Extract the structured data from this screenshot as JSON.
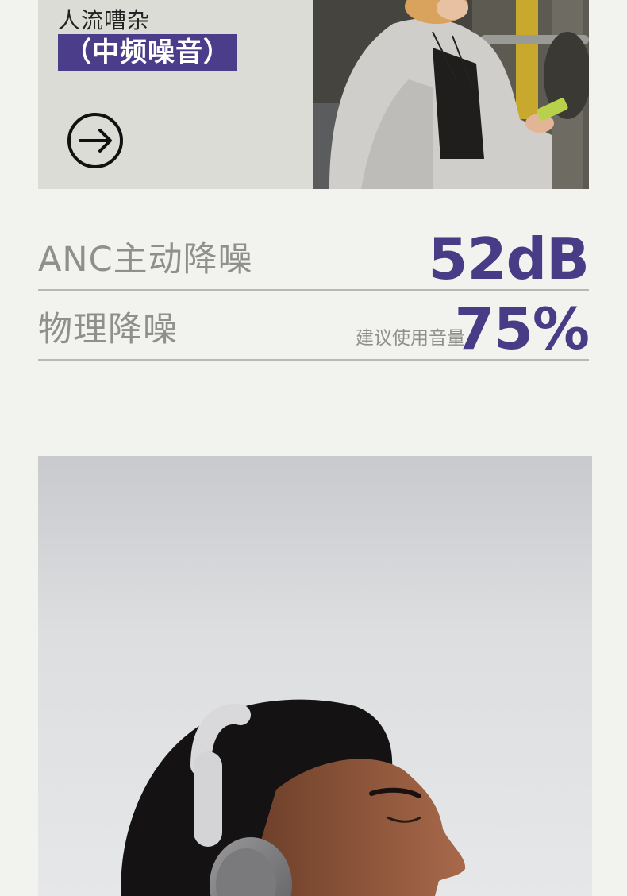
{
  "scene_card": {
    "scene_text": "人流嘈杂",
    "badge_text": "（中频噪音）",
    "arrow_icon": "arrow-right-circle-icon",
    "photo": "woman-on-subway-with-phone"
  },
  "specs": [
    {
      "label": "ANC主动降噪",
      "sub": "",
      "value": "52dB"
    },
    {
      "label": "物理降噪",
      "sub": "建议使用音量",
      "value": "75%"
    }
  ],
  "hero": {
    "photo": "man-wearing-headphones-eyes-closed"
  },
  "colors": {
    "accent": "#493c86",
    "badge_bg": "#4b3d8a",
    "label_gray": "#8f8f8c",
    "page_bg": "#f2f2ee"
  }
}
